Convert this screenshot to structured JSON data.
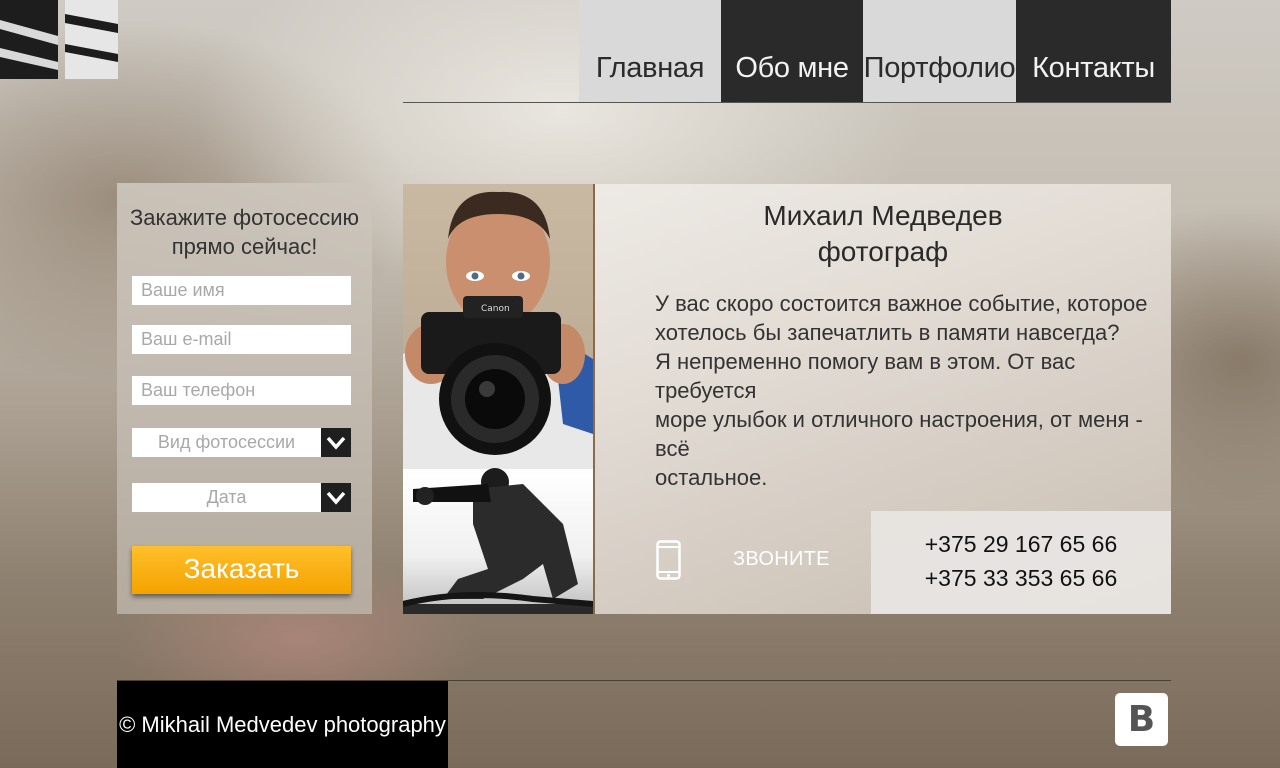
{
  "nav": {
    "items": [
      {
        "label": "Главная"
      },
      {
        "label": "Обо мне"
      },
      {
        "label": "Портфолио"
      },
      {
        "label": "Контакты"
      }
    ]
  },
  "order_form": {
    "title_line1": "Закажите фотосессию",
    "title_line2": "прямо сейчас!",
    "name_placeholder": "Ваше имя",
    "email_placeholder": "Ваш e-mail",
    "phone_placeholder": "Ваш телефон",
    "session_type_placeholder": "Вид фотосессии",
    "date_placeholder": "Дата",
    "submit_label": "Заказать"
  },
  "profile": {
    "name": "Михаил Медведев",
    "role": "фотограф",
    "about_lines": [
      "У вас скоро состоится важное событие, которое",
      "хотелось бы запечатлить в памяти навсегда?",
      "Я непременно помогу вам в этом. От вас требуется",
      "море улыбок и отличного настроения, от меня - всё",
      "остальное."
    ]
  },
  "contact": {
    "call_label": "ЗВОНИТЕ",
    "phone_1": "+375 29 167 65 66",
    "phone_2": "+375 33 353 65 66"
  },
  "footer": {
    "copyright": "© Mikhail Medvedev photography",
    "social_vk": "B"
  },
  "colors": {
    "accent_orange": "#f4a300",
    "nav_dark": "#2a2a2a",
    "nav_light": "#d9d9d9"
  }
}
